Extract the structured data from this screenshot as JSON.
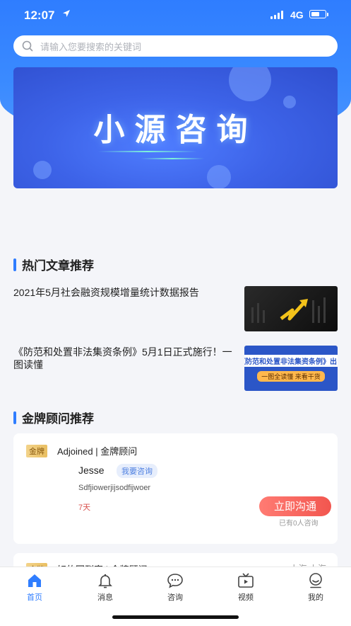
{
  "status_bar": {
    "time": "12:07",
    "network": "4G"
  },
  "search": {
    "placeholder": "请输入您要搜索的关键词"
  },
  "banner": {
    "title": "小源咨询"
  },
  "hot_articles": {
    "title": "热门文章推荐",
    "items": [
      {
        "title": "2021年5月社会融资规模增量统计数据报告"
      },
      {
        "title": "《防范和处置非法集资条例》5月1日正式施行！一图读懂",
        "thumb_text": "《防范和处置非法集资条例》出台",
        "thumb_sub": "一图全读懂 来看干货"
      }
    ]
  },
  "advisors": {
    "title": "金牌顾问推荐",
    "items": [
      {
        "badge": "金牌",
        "header": "Adjoined | 金牌顾问",
        "name": "Jesse",
        "consult_tag": "我要咨询",
        "description": "Sdfjiowerjijsodfijwoer",
        "days": "7天",
        "button": "立即沟通",
        "count": "已有0人咨询"
      },
      {
        "badge": "金牌",
        "header": "好的回到家 | 金牌顾问",
        "location": "上海 上海"
      }
    ]
  },
  "tab_bar": {
    "items": [
      {
        "label": "首页",
        "icon": "home-icon"
      },
      {
        "label": "消息",
        "icon": "bell-icon"
      },
      {
        "label": "咨询",
        "icon": "chat-icon"
      },
      {
        "label": "视频",
        "icon": "tv-icon"
      },
      {
        "label": "我的",
        "icon": "profile-icon"
      }
    ]
  },
  "colors": {
    "accent": "#2f7dff",
    "button": "#f2564f",
    "gold": "#e9bf62"
  }
}
